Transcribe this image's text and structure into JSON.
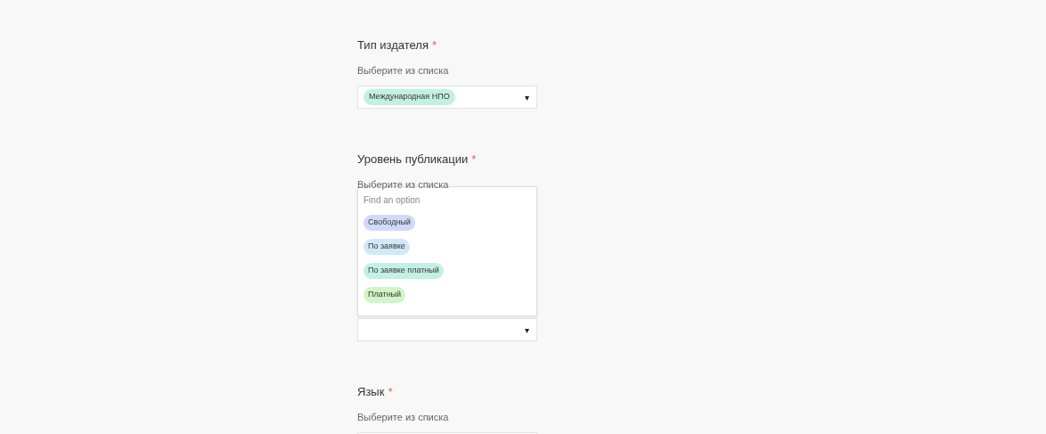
{
  "fields": [
    {
      "label": "Тип издателя",
      "required_mark": "*",
      "hint": "Выберите из списка",
      "value": {
        "label": "Международная НПО",
        "color": "#c4f0e4"
      },
      "caret": "▾"
    },
    {
      "label": "Уровень публикации",
      "required_mark": "*",
      "hint": "Выберите из списка",
      "dropdown": {
        "placeholder": "Find an option",
        "options": [
          {
            "label": "Свободный",
            "color": "#d0daf8"
          },
          {
            "label": "По заявке",
            "color": "#cfe9fa"
          },
          {
            "label": "По заявке платный",
            "color": "#c4f0e4"
          },
          {
            "label": "Платный",
            "color": "#d1f5c6"
          }
        ]
      },
      "caret": "▾"
    },
    {
      "label": "Язык",
      "required_mark": "*",
      "hint": "Выберите из списка"
    }
  ]
}
